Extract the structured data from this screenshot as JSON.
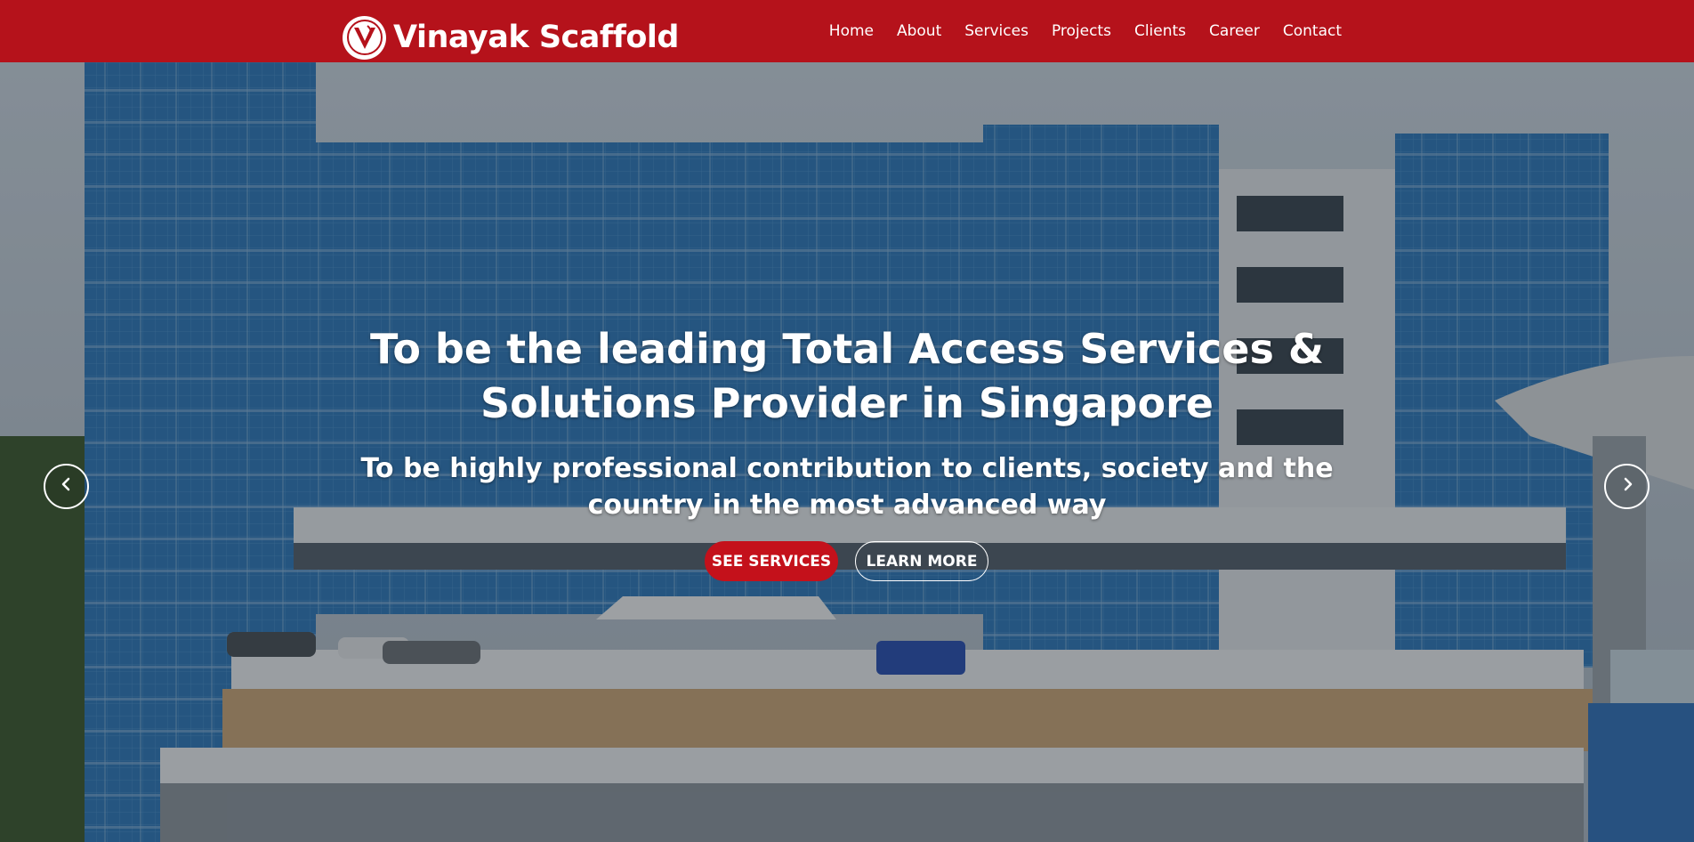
{
  "brand": {
    "name": "Vinayak Scaffold",
    "logo_icon": "vinayak-v-logo-icon"
  },
  "nav": {
    "items": [
      {
        "label": "Home"
      },
      {
        "label": "About"
      },
      {
        "label": "Services"
      },
      {
        "label": "Projects"
      },
      {
        "label": "Clients"
      },
      {
        "label": "Career"
      },
      {
        "label": "Contact"
      }
    ]
  },
  "hero": {
    "title": "To be the leading Total Access Services & Solutions Provider in Singapore",
    "subtitle": "To be highly professional contribution to clients, society and the country in the most advanced way",
    "primary_button": "SEE SERVICES",
    "secondary_button": "LEARN MORE",
    "prev_icon": "chevron-left-icon",
    "next_icon": "chevron-right-icon"
  },
  "colors": {
    "brand_red": "#b5121b",
    "button_red": "#c4111b"
  }
}
